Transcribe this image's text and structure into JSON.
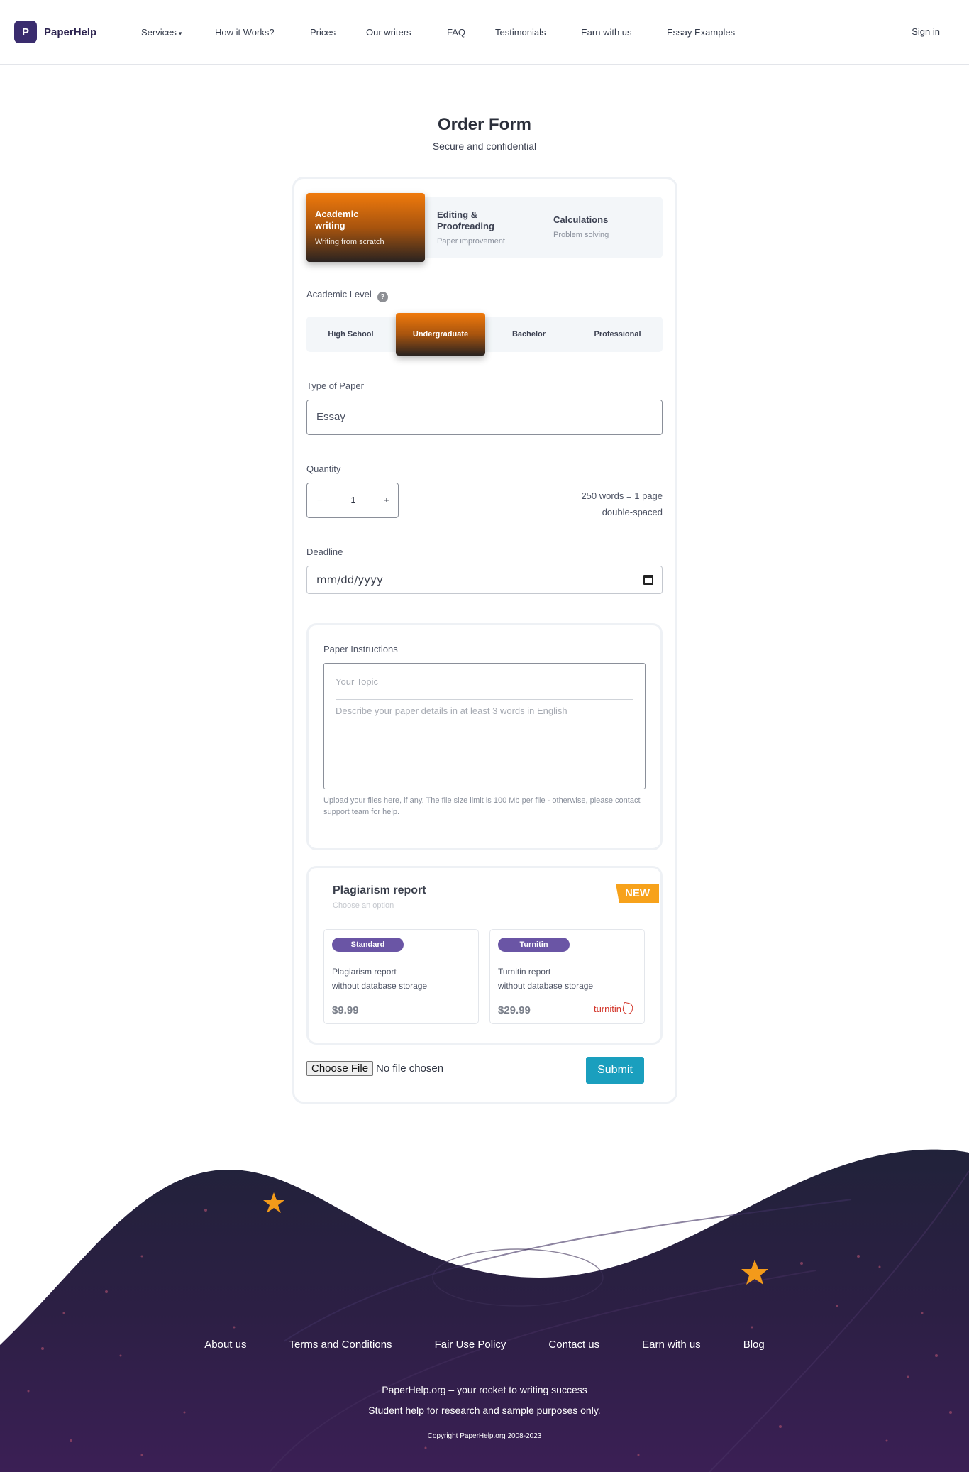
{
  "header": {
    "logo_letter": "P",
    "logo_text": "PaperHelp",
    "nav": [
      "Services",
      "How it Works?",
      "Prices",
      "Our writers",
      "FAQ",
      "Testimonials",
      "Earn with us",
      "Essay Examples"
    ],
    "signin": "Sign in"
  },
  "page": {
    "title": "Order Form",
    "subtitle": "Secure and confidential"
  },
  "service_tabs": [
    {
      "title": "Academic writing",
      "subtitle": "Writing from scratch",
      "active": true
    },
    {
      "title": "Editing & Proofreading",
      "subtitle": "Paper improvement",
      "active": false
    },
    {
      "title": "Calculations",
      "subtitle": "Problem solving",
      "active": false
    }
  ],
  "academic_level": {
    "label": "Academic Level",
    "help": "?",
    "options": [
      "High School",
      "Undergraduate",
      "Bachelor",
      "Professional"
    ],
    "selected": "Undergraduate"
  },
  "paper_type": {
    "label": "Type of Paper",
    "value": "Essay"
  },
  "quantity": {
    "label": "Quantity",
    "minus": "−",
    "value": "1",
    "plus": "+",
    "note_line1": "250 words = 1 page",
    "note_line2": "double-spaced"
  },
  "deadline": {
    "label": "Deadline",
    "placeholder": "mm/dd/yyyy"
  },
  "instructions": {
    "label": "Paper Instructions",
    "topic_placeholder": "Your Topic",
    "details_placeholder": "Describe your paper details in at least 3 words in English",
    "upload_note": "Upload your files here, if any. The file size limit is 100 Mb per file - otherwise, please contact support team for help."
  },
  "plagiarism": {
    "title": "Plagiarism report",
    "subtitle": "Choose an option",
    "badge": "NEW",
    "options": [
      {
        "name": "Standard",
        "line1": "Plagiarism report",
        "line2": "without database storage",
        "price": "$9.99"
      },
      {
        "name": "Turnitin",
        "line1": "Turnitin report",
        "line2": "without database storage",
        "price": "$29.99",
        "logo_text": "turnitin"
      }
    ]
  },
  "file": {
    "button": "Choose File",
    "status": "No file chosen"
  },
  "submit": "Submit",
  "footer": {
    "links": [
      "About us",
      "Terms and Conditions",
      "Fair Use Policy",
      "Contact us",
      "Earn with us",
      "Blog"
    ],
    "tagline1": "PaperHelp.org – your rocket to writing success",
    "tagline2": "Student help for research and sample purposes only.",
    "copyright": "Copyright PaperHelp.org 2008-2023"
  },
  "colors": {
    "accent_orange": "#f07a0c",
    "brand_purple": "#3a2c6e",
    "submit_teal": "#1a9fbe",
    "pill_purple": "#6a55a5",
    "footer_dark": "#2a1f40"
  }
}
